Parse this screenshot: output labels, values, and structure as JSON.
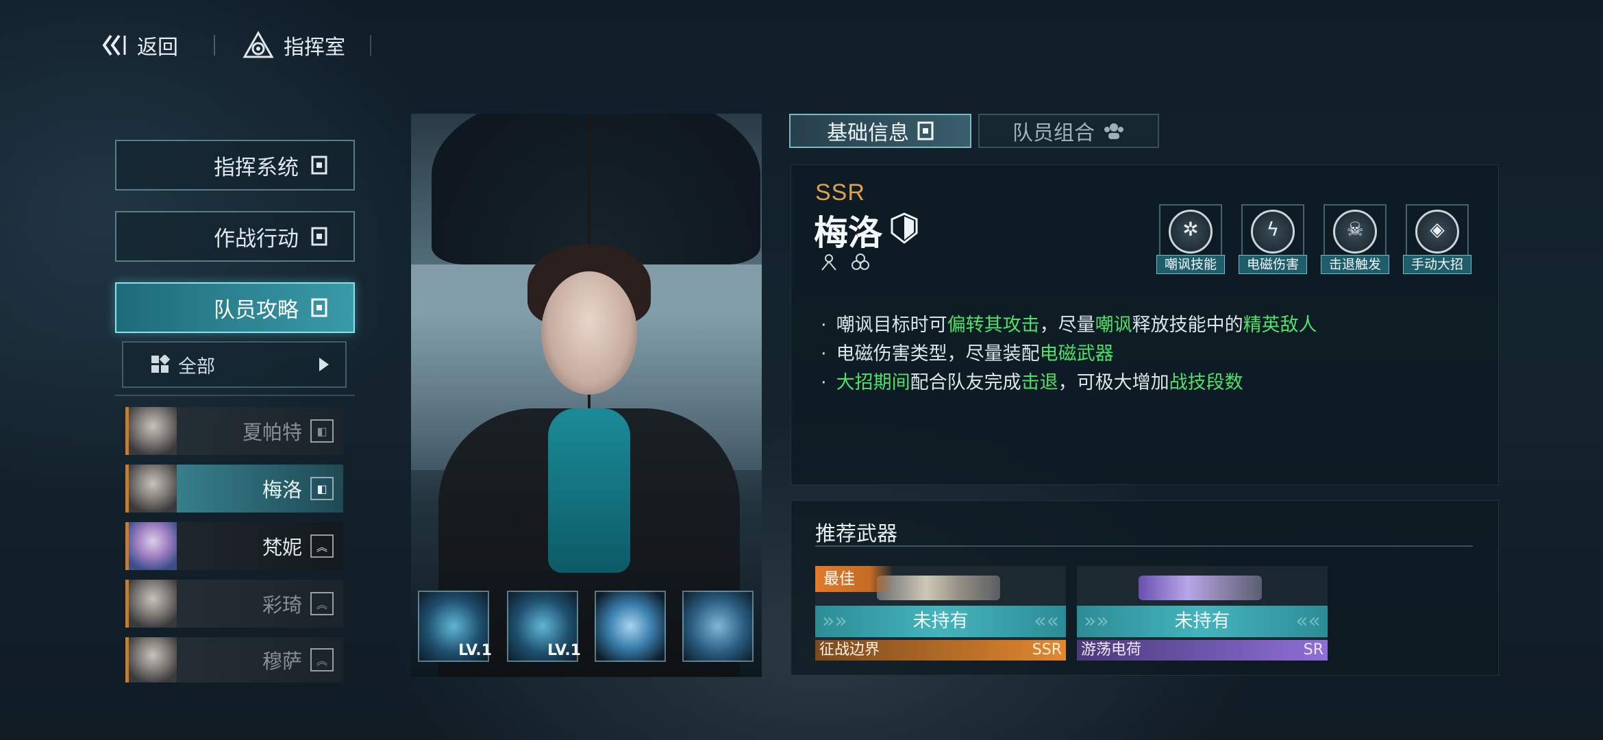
{
  "topbar": {
    "back_label": "返回",
    "room_label": "指挥室"
  },
  "nav": {
    "items": [
      {
        "label": "指挥系统"
      },
      {
        "label": "作战行动"
      },
      {
        "label": "队员攻略"
      }
    ],
    "filter_label": "全部"
  },
  "members": [
    {
      "name": "夏帕特",
      "badge": "shield"
    },
    {
      "name": "梅洛",
      "badge": "shield"
    },
    {
      "name": "梵妮",
      "badge": "chevron"
    },
    {
      "name": "彩琦",
      "badge": "chevron"
    },
    {
      "name": "穆萨",
      "badge": "chevron"
    }
  ],
  "skills": [
    {
      "icon": "skill-figure-icon",
      "level": "LV.1"
    },
    {
      "icon": "skill-burst-icon",
      "level": "LV.1"
    },
    {
      "icon": "skill-vortex-icon",
      "level": ""
    },
    {
      "icon": "skill-umbrella-icon",
      "level": ""
    }
  ],
  "tabs": [
    {
      "label": "基础信息"
    },
    {
      "label": "队员组合"
    }
  ],
  "character": {
    "rarity": "SSR",
    "name": "梅洛",
    "tags": [
      "嘲讽技能",
      "电磁伤害",
      "击退触发",
      "手动大招"
    ]
  },
  "tips": {
    "line1": [
      "嘲讽目标时可",
      "偏转其攻击",
      "，尽量",
      "嘲讽",
      "释放技能中的",
      "精英敌人"
    ],
    "line2": [
      "电磁伤害类型，尽量装配",
      "电磁武器"
    ],
    "line3": [
      "大招期间",
      "配合队友完成",
      "击退",
      "，可极大增加",
      "战技段数"
    ]
  },
  "weapons": {
    "title": "推荐武器",
    "items": [
      {
        "best_label": "最佳",
        "status": "未持有",
        "name": "征战边界",
        "rarity": "SSR",
        "color": "#e3882e"
      },
      {
        "best_label": "",
        "status": "未持有",
        "name": "游荡电荷",
        "rarity": "SR",
        "color": "#9b6fe0"
      }
    ]
  },
  "colors": {
    "accent": "#45b4bc",
    "highlight_green": "#4ee06a",
    "ssr_orange": "#e3a04a"
  }
}
